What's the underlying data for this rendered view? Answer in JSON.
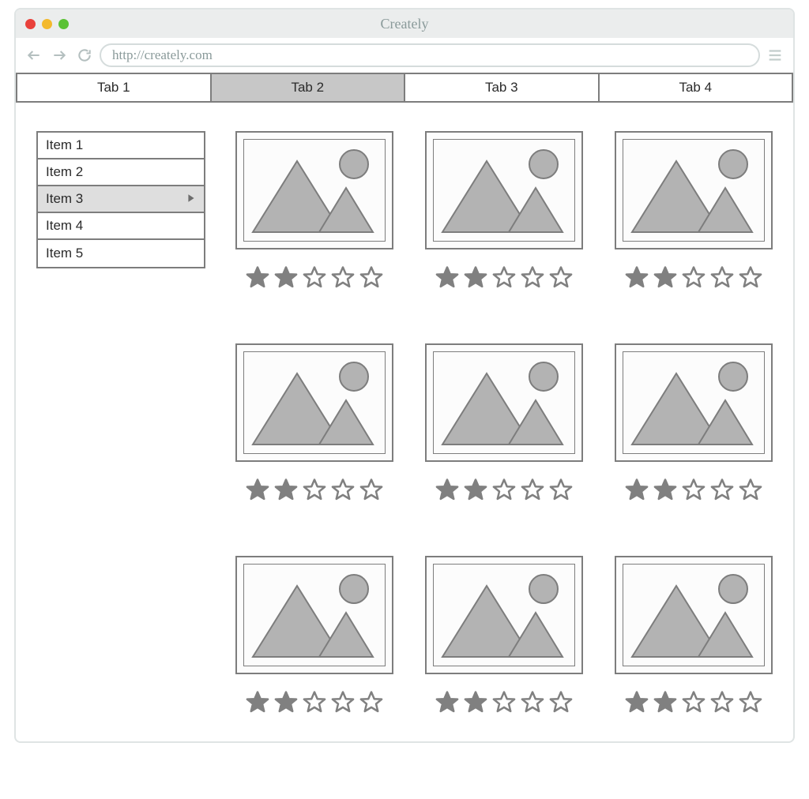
{
  "browser": {
    "title": "Creately",
    "url": "http://creately.com"
  },
  "tabs": [
    "Tab 1",
    "Tab 2",
    "Tab 3",
    "Tab 4"
  ],
  "active_tab_index": 1,
  "sidebar": {
    "items": [
      "Item 1",
      "Item 2",
      "Item 3",
      "Item 4",
      "Item 5"
    ],
    "active_index": 2
  },
  "grid": {
    "rows": 3,
    "cols": 3,
    "rating": {
      "filled": 2,
      "total": 5
    }
  },
  "colors": {
    "border": "#7d7d7d",
    "fill": "#b3b3b3",
    "star_filled": "#808080",
    "star_empty_stroke": "#808080"
  }
}
